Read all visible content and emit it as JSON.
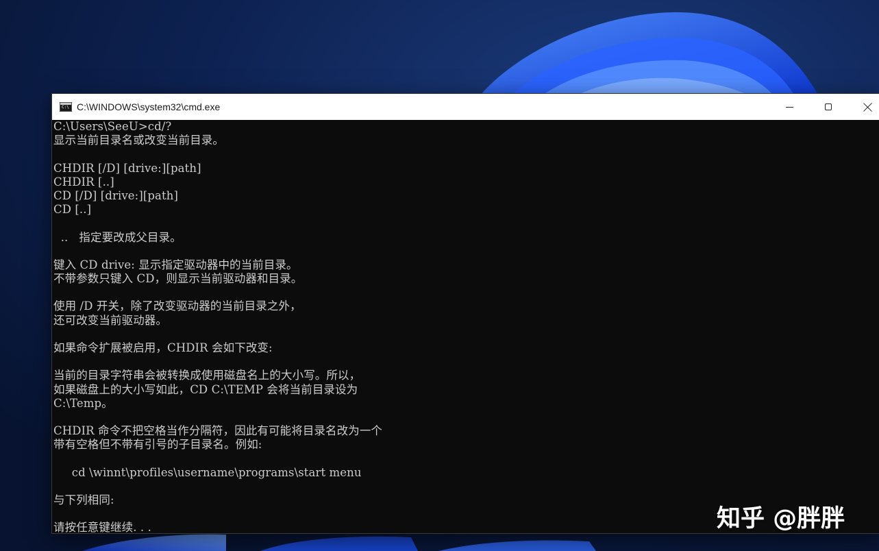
{
  "window": {
    "title": "C:\\WINDOWS\\system32\\cmd.exe",
    "icon_text": "C:\\",
    "icons": {
      "app": "cmd-icon",
      "minimize": "minimize-icon",
      "maximize": "maximize-icon",
      "close": "close-icon"
    }
  },
  "console": {
    "lines": [
      "C:\\Users\\SeeU>cd/?",
      "显示当前目录名或改变当前目录。",
      "",
      "CHDIR [/D] [drive:][path]",
      "CHDIR [..]",
      "CD [/D] [drive:][path]",
      "CD [..]",
      "",
      "  ..   指定要改成父目录。",
      "",
      "键入 CD drive: 显示指定驱动器中的当前目录。",
      "不带参数只键入 CD，则显示当前驱动器和目录。",
      "",
      "使用 /D 开关，除了改变驱动器的当前目录之外，",
      "还可改变当前驱动器。",
      "",
      "如果命令扩展被启用，CHDIR 会如下改变:",
      "",
      "当前的目录字符串会被转换成使用磁盘名上的大小写。所以，",
      "如果磁盘上的大小写如此，CD C:\\TEMP 会将当前目录设为",
      "C:\\Temp。",
      "",
      "CHDIR 命令不把空格当作分隔符，因此有可能将目录名改为一个",
      "带有空格但不带有引号的子目录名。例如:",
      "",
      "     cd \\winnt\\profiles\\username\\programs\\start menu",
      "",
      "与下列相同:",
      "",
      "请按任意键继续. . ."
    ]
  },
  "watermark": {
    "text": "知乎 @胖胖"
  },
  "colors": {
    "console_bg": "#0c0c0c",
    "console_text": "#cccccc",
    "titlebar_bg": "#ffffff",
    "desktop_bg": "#0b1a3d",
    "bloom_blue": "#1f5bff"
  }
}
